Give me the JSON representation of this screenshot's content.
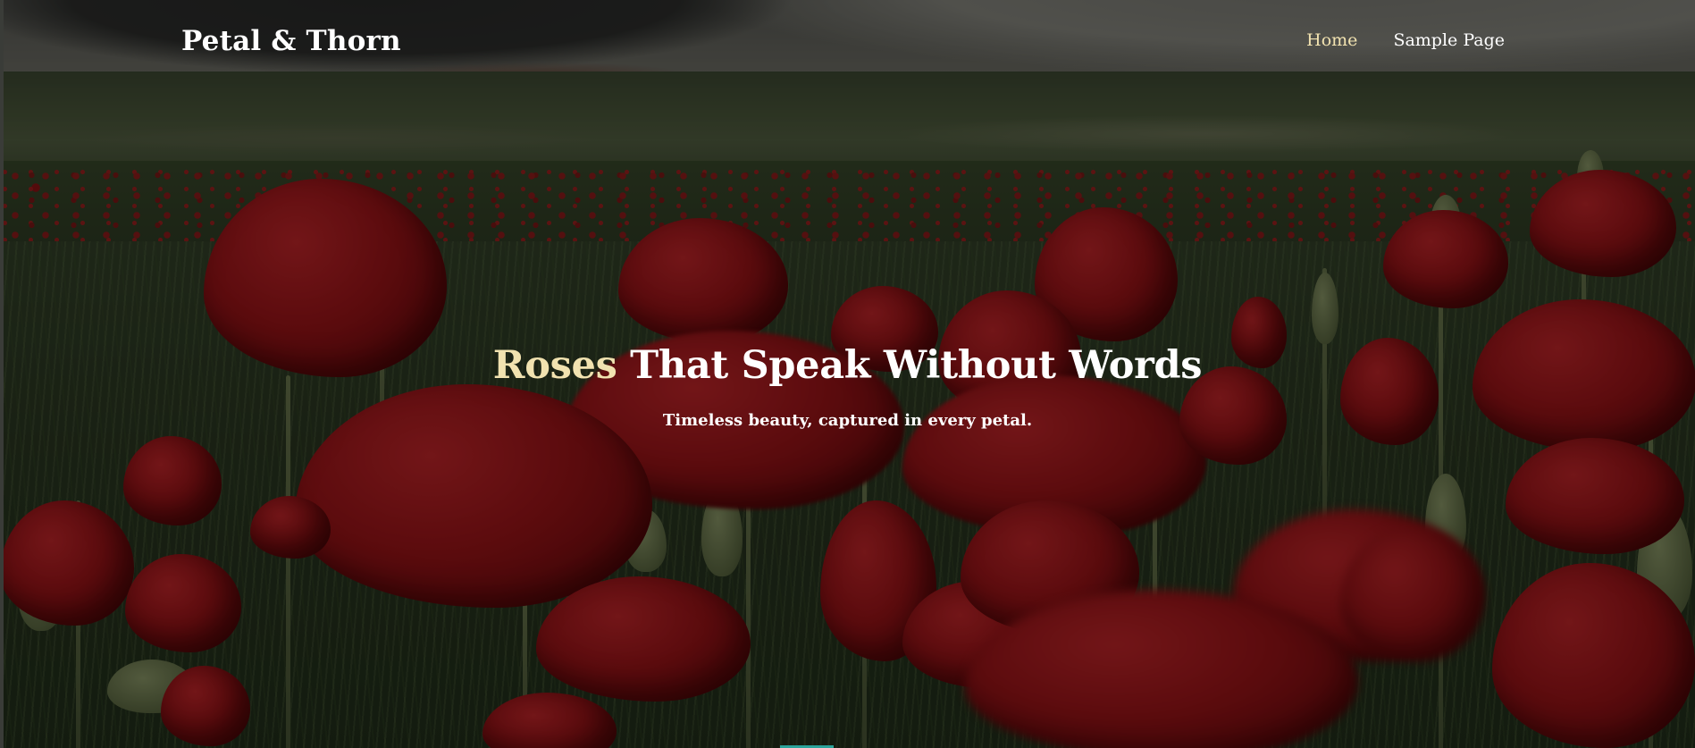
{
  "site": {
    "title": "Petal & Thorn"
  },
  "nav": {
    "items": [
      {
        "label": "Home",
        "current": true
      },
      {
        "label": "Sample Page",
        "current": false
      }
    ]
  },
  "hero": {
    "title_accent": "Roses",
    "title_rest": " That Speak Without Words",
    "subtitle": "Timeless beauty, captured in every petal.",
    "background": "poppy-field-photo"
  },
  "colors": {
    "accent": "#f1e2b0",
    "text": "#ffffff",
    "overlay": "rgba(0,0,0,0.42)",
    "poppy_red": "#9e1418",
    "indicator": "#2aa39a"
  }
}
